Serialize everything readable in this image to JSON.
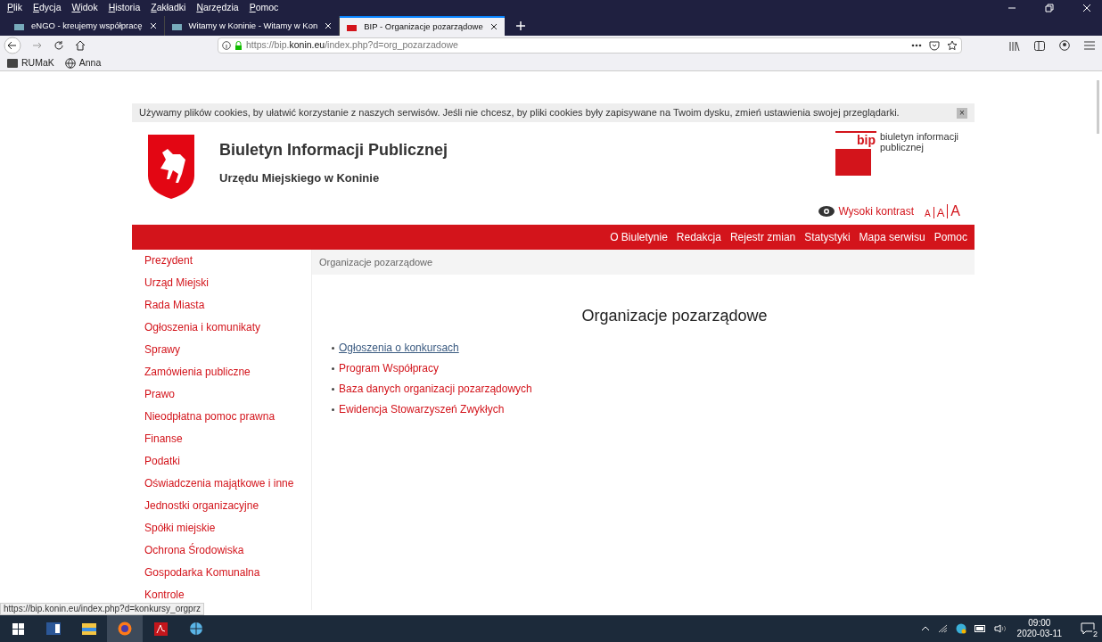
{
  "menu_bar": [
    "Plik",
    "Edycja",
    "Widok",
    "Historia",
    "Zakładki",
    "Narzędzia",
    "Pomoc"
  ],
  "tabs": [
    {
      "label": "eNGO - kreujemy współpracę",
      "selected": false
    },
    {
      "label": "Witamy w Koninie - Witamy w Kon",
      "selected": false
    },
    {
      "label": "BIP - Organizacje pozarządowe",
      "selected": true
    }
  ],
  "address_bar": {
    "prefix": "https://bip.",
    "domain": "konin.eu",
    "path": "/index.php?d=org_pozarzadowe"
  },
  "bookmarks": [
    "RUMaK",
    "Anna"
  ],
  "cookie_notice": {
    "text": "Używamy plików cookies, by ułatwić korzystanie z naszych serwisów. Jeśli nie chcesz, by pliki cookies były zapisywane na Twoim dysku, zmień ustawienia swojej przeglądarki.",
    "close": "×"
  },
  "header": {
    "title": "Biuletyn Informacji Publicznej",
    "subtitle": "Urzędu Miejskiego w Koninie",
    "bip_mark": "bip",
    "bip_text": "biuletyn informacji publicznej",
    "contrast": "Wysoki kontrast",
    "font_sizes": [
      "A",
      "A",
      "A"
    ]
  },
  "nav": [
    "O Biuletynie",
    "Redakcja",
    "Rejestr zmian",
    "Statystyki",
    "Mapa serwisu",
    "Pomoc"
  ],
  "sidebar": [
    "Prezydent",
    "Urząd Miejski",
    "Rada Miasta",
    "Ogłoszenia i komunikaty",
    "Sprawy",
    "Zamówienia publiczne",
    "Prawo",
    "Nieodpłatna pomoc prawna",
    "Finanse",
    "Podatki",
    "Oświadczenia majątkowe i inne",
    "Jednostki organizacyjne",
    "Spółki miejskie",
    "Ochrona Środowiska",
    "Gospodarka Komunalna",
    "Kontrole"
  ],
  "breadcrumb": "Organizacje pozarządowe",
  "heading": "Organizacje pozarządowe",
  "links": [
    {
      "label": "Ogłoszenia o konkursach",
      "hovered": true
    },
    {
      "label": "Program Współpracy",
      "hovered": false
    },
    {
      "label": "Baza danych organizacji pozarządowych",
      "hovered": false
    },
    {
      "label": "Ewidencja Stowarzyszeń Zwykłych",
      "hovered": false
    }
  ],
  "status_url": "https://bip.konin.eu/index.php?d=konkursy_orgprz",
  "taskbar": {
    "time": "09:00",
    "date": "2020-03-11",
    "notifications": "2"
  }
}
